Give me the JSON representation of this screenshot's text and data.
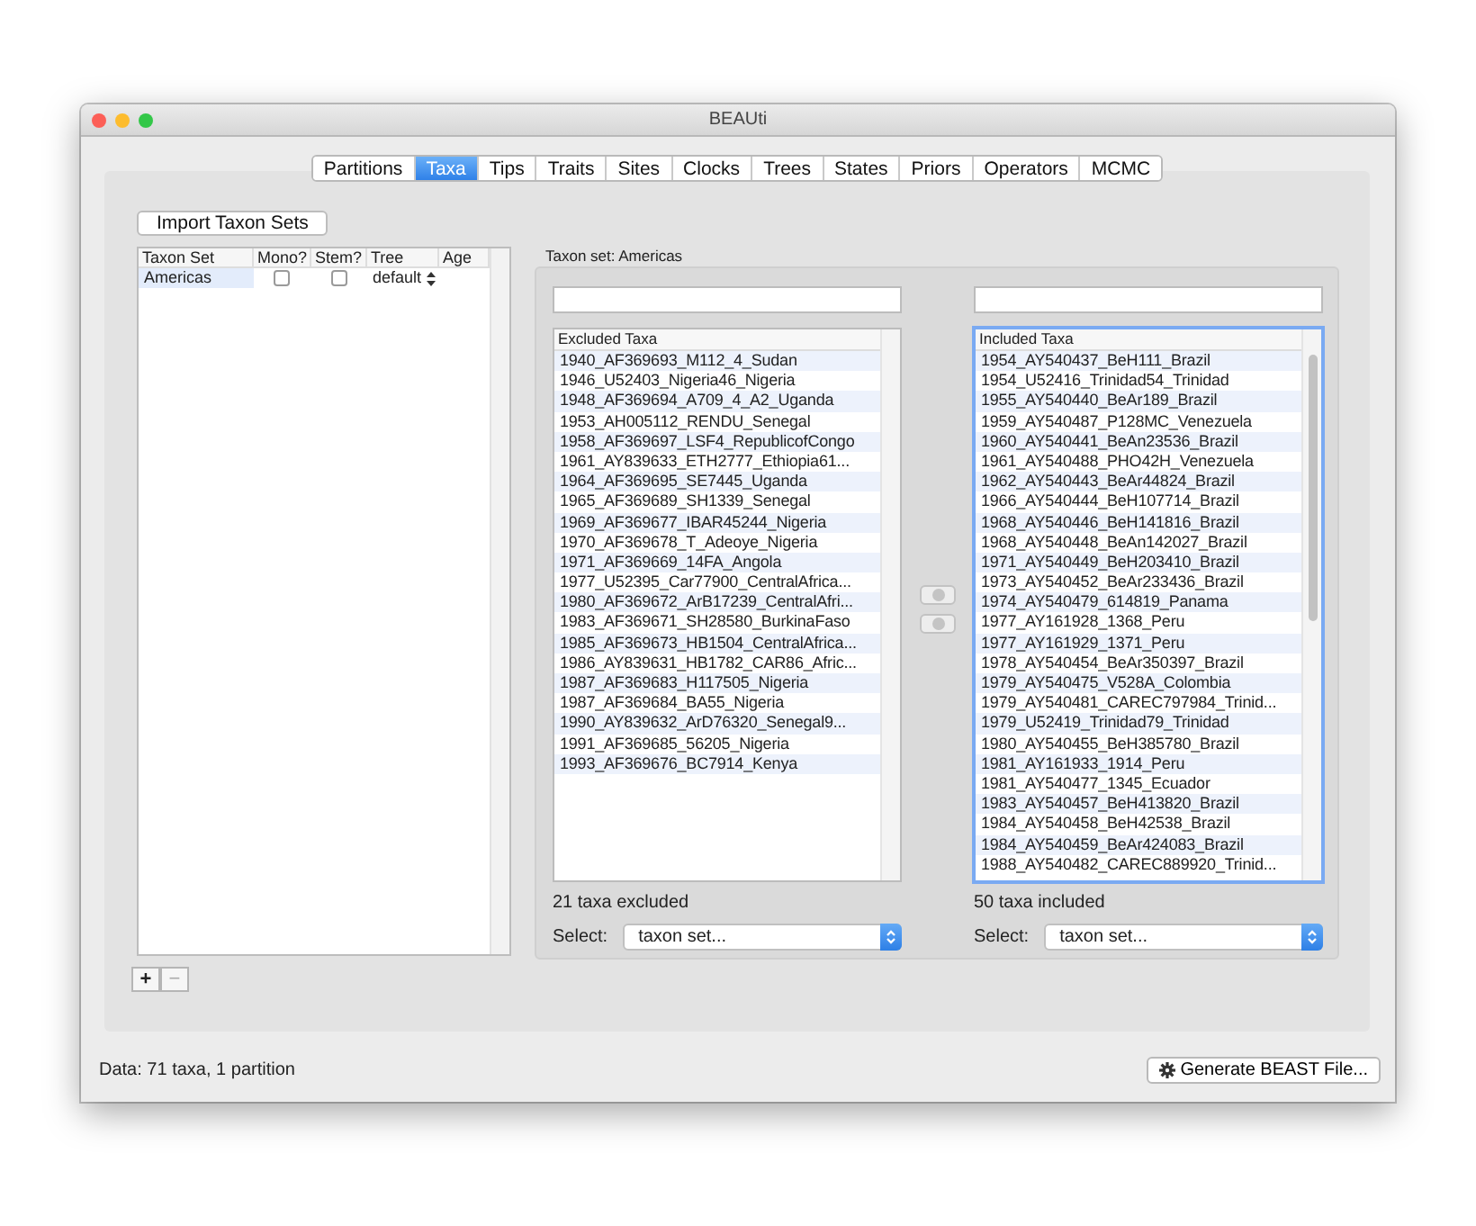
{
  "window": {
    "title": "BEAUti"
  },
  "tabs": [
    {
      "label": "Partitions",
      "selected": false
    },
    {
      "label": "Taxa",
      "selected": true
    },
    {
      "label": "Tips",
      "selected": false
    },
    {
      "label": "Traits",
      "selected": false
    },
    {
      "label": "Sites",
      "selected": false
    },
    {
      "label": "Clocks",
      "selected": false
    },
    {
      "label": "Trees",
      "selected": false
    },
    {
      "label": "States",
      "selected": false
    },
    {
      "label": "Priors",
      "selected": false
    },
    {
      "label": "Operators",
      "selected": false
    },
    {
      "label": "MCMC",
      "selected": false
    }
  ],
  "import_button": "Import Taxon Sets",
  "taxon_sets": {
    "columns": [
      "Taxon Set",
      "Mono?",
      "Stem?",
      "Tree",
      "Age"
    ],
    "rows": [
      {
        "name": "Americas",
        "selected": true,
        "mono": false,
        "stem": false,
        "tree": "default"
      }
    ]
  },
  "list_buttons": [
    {
      "label": "+",
      "disabled": false
    },
    {
      "label": "−",
      "disabled": true
    }
  ],
  "taxon_set_title": "Taxon set: Americas",
  "lists": [
    {
      "header": "Excluded Taxa",
      "focused": false,
      "count": "21 taxa excluded",
      "select_label": "Select:",
      "select_value": "taxon set...",
      "items": [
        "1940_AF369693_M112_4_Sudan",
        "1946_U52403_Nigeria46_Nigeria",
        "1948_AF369694_A709_4_A2_Uganda",
        "1953_AH005112_RENDU_Senegal",
        "1958_AF369697_LSF4_RepublicofCongo",
        "1961_AY839633_ETH2777_Ethiopia61...",
        "1964_AF369695_SE7445_Uganda",
        "1965_AF369689_SH1339_Senegal",
        "1969_AF369677_IBAR45244_Nigeria",
        "1970_AF369678_T_Adeoye_Nigeria",
        "1971_AF369669_14FA_Angola",
        "1977_U52395_Car77900_CentralAfrica...",
        "1980_AF369672_ArB17239_CentralAfri...",
        "1983_AF369671_SH28580_BurkinaFaso",
        "1985_AF369673_HB1504_CentralAfrica...",
        "1986_AY839631_HB1782_CAR86_Afric...",
        "1987_AF369683_H117505_Nigeria",
        "1987_AF369684_BA55_Nigeria",
        "1990_AY839632_ArD76320_Senegal9...",
        "1991_AF369685_56205_Nigeria",
        "1993_AF369676_BC7914_Kenya"
      ]
    },
    {
      "header": "Included Taxa",
      "focused": true,
      "count": "50 taxa included",
      "select_label": "Select:",
      "select_value": "taxon set...",
      "items": [
        "1954_AY540437_BeH111_Brazil",
        "1954_U52416_Trinidad54_Trinidad",
        "1955_AY540440_BeAr189_Brazil",
        "1959_AY540487_P128MC_Venezuela",
        "1960_AY540441_BeAn23536_Brazil",
        "1961_AY540488_PHO42H_Venezuela",
        "1962_AY540443_BeAr44824_Brazil",
        "1966_AY540444_BeH107714_Brazil",
        "1968_AY540446_BeH141816_Brazil",
        "1968_AY540448_BeAn142027_Brazil",
        "1971_AY540449_BeH203410_Brazil",
        "1973_AY540452_BeAr233436_Brazil",
        "1974_AY540479_614819_Panama",
        "1977_AY161928_1368_Peru",
        "1977_AY161929_1371_Peru",
        "1978_AY540454_BeAr350397_Brazil",
        "1979_AY540475_V528A_Colombia",
        "1979_AY540481_CAREC797984_Trinid...",
        "1979_U52419_Trinidad79_Trinidad",
        "1980_AY540455_BeH385780_Brazil",
        "1981_AY161933_1914_Peru",
        "1981_AY540477_1345_Ecuador",
        "1983_AY540457_BeH413820_Brazil",
        "1984_AY540458_BeH42538_Brazil",
        "1984_AY540459_BeAr424083_Brazil",
        "1988_AY540482_CAREC889920_Trinid..."
      ]
    }
  ],
  "move_buttons": [
    {
      "disabled": true
    },
    {
      "disabled": true
    }
  ],
  "status": "Data: 71 taxa, 1 partition",
  "generate_button": "Generate BEAST File..."
}
